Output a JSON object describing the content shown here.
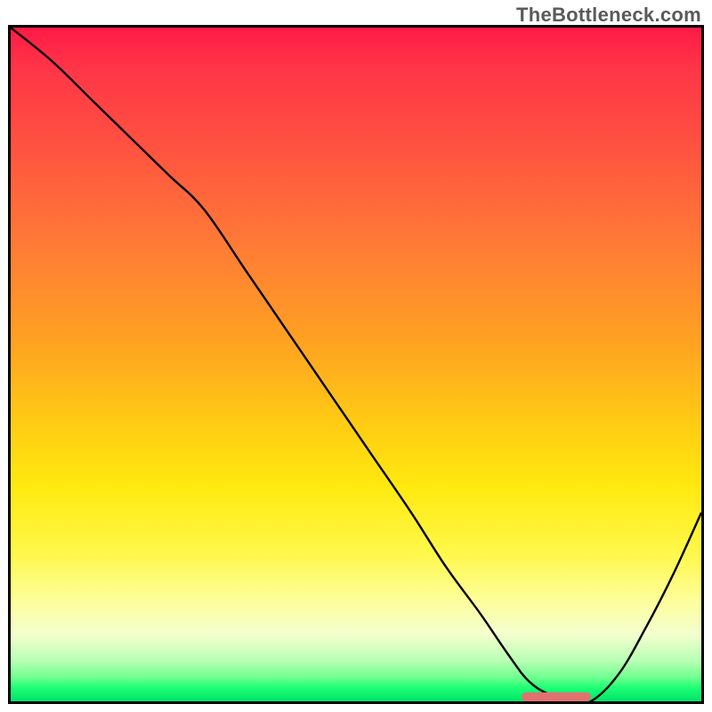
{
  "watermark": "TheBottleneck.com",
  "colors": {
    "frame": "#000000",
    "curve": "#000000",
    "sweet_spot": "#e2716f"
  },
  "chart_data": {
    "type": "line",
    "title": "",
    "xlabel": "",
    "ylabel": "",
    "xlim": [
      0,
      100
    ],
    "ylim": [
      0,
      100
    ],
    "grid": false,
    "note": "Axes are hidden; values are normalized 0–100 to the visible plot area. y = 0 at the bottom (green), y = 100 at the top (red). Curve is the bottleneck/mismatch percentage vs. relative performance.",
    "series": [
      {
        "name": "bottleneck-curve",
        "x": [
          0,
          6,
          12,
          18,
          23,
          28,
          34,
          40,
          46,
          52,
          58,
          63,
          68,
          72,
          75,
          78,
          81,
          84,
          88,
          92,
          96,
          100
        ],
        "values": [
          100,
          95,
          89,
          83,
          78,
          73,
          64,
          55,
          46,
          37,
          28,
          20,
          13,
          7,
          3,
          1,
          0,
          0,
          4,
          11,
          19,
          28
        ]
      }
    ],
    "sweet_spot": {
      "x_start": 74,
      "x_end": 84,
      "y": 0.6
    },
    "background_gradient": {
      "orientation": "vertical",
      "stops": [
        {
          "pos": 0.0,
          "color": "#ff1a47"
        },
        {
          "pos": 0.18,
          "color": "#ff5340"
        },
        {
          "pos": 0.46,
          "color": "#ffa022"
        },
        {
          "pos": 0.68,
          "color": "#ffe90e"
        },
        {
          "pos": 0.9,
          "color": "#f4ffce"
        },
        {
          "pos": 1.0,
          "color": "#00e46a"
        }
      ]
    }
  }
}
